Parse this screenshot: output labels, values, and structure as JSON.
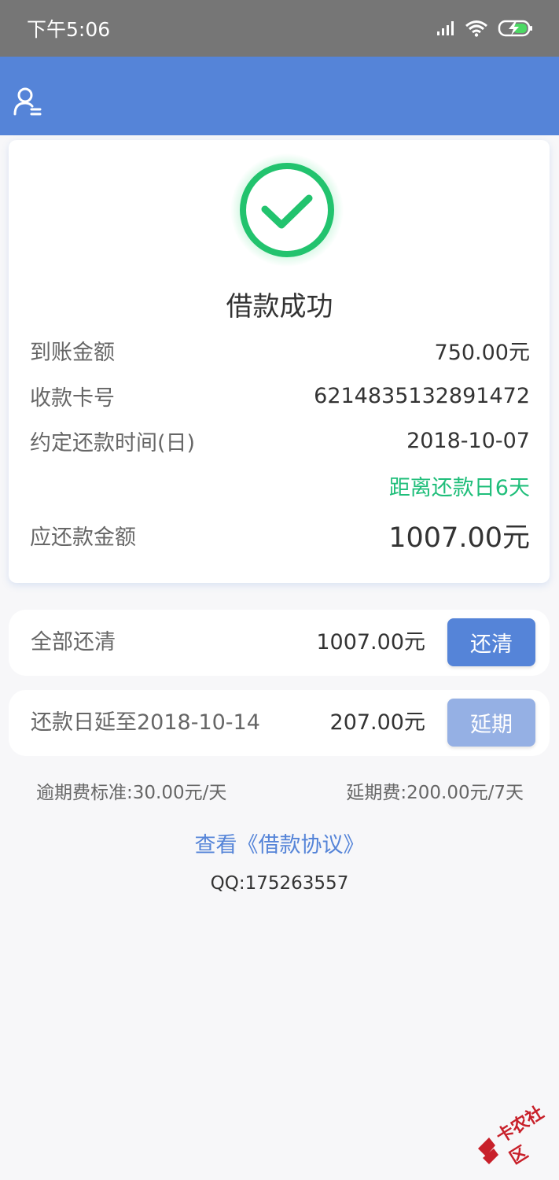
{
  "status_bar": {
    "time": "下午5:06"
  },
  "header": {
    "user_icon": "user-menu-icon"
  },
  "result_card": {
    "status_icon": "check-circle-icon",
    "title": "借款成功",
    "rows": [
      {
        "label": "到账金额",
        "value": "750.00元"
      },
      {
        "label": "收款卡号",
        "value": "6214835132891472"
      },
      {
        "label": "约定还款时间(日)",
        "value": "2018-10-07"
      }
    ],
    "countdown": "距离还款日6天",
    "due_label": "应还款金额",
    "due_value": "1007.00元"
  },
  "repay_all": {
    "label": "全部还清",
    "amount": "1007.00元",
    "button_label": "还清"
  },
  "extend": {
    "label": "还款日延至2018-10-14",
    "amount": "207.00元",
    "button_label": "延期"
  },
  "fees": {
    "overdue": "逾期费标准:30.00元/天",
    "extension": "延期费:200.00元/7天"
  },
  "agreement_link": "查看《借款协议》",
  "contact": "QQ:175263557",
  "watermark": "卡农社区",
  "colors": {
    "primary": "#5584d8",
    "success": "#1fbe7a",
    "button_light": "#95b0e4"
  }
}
